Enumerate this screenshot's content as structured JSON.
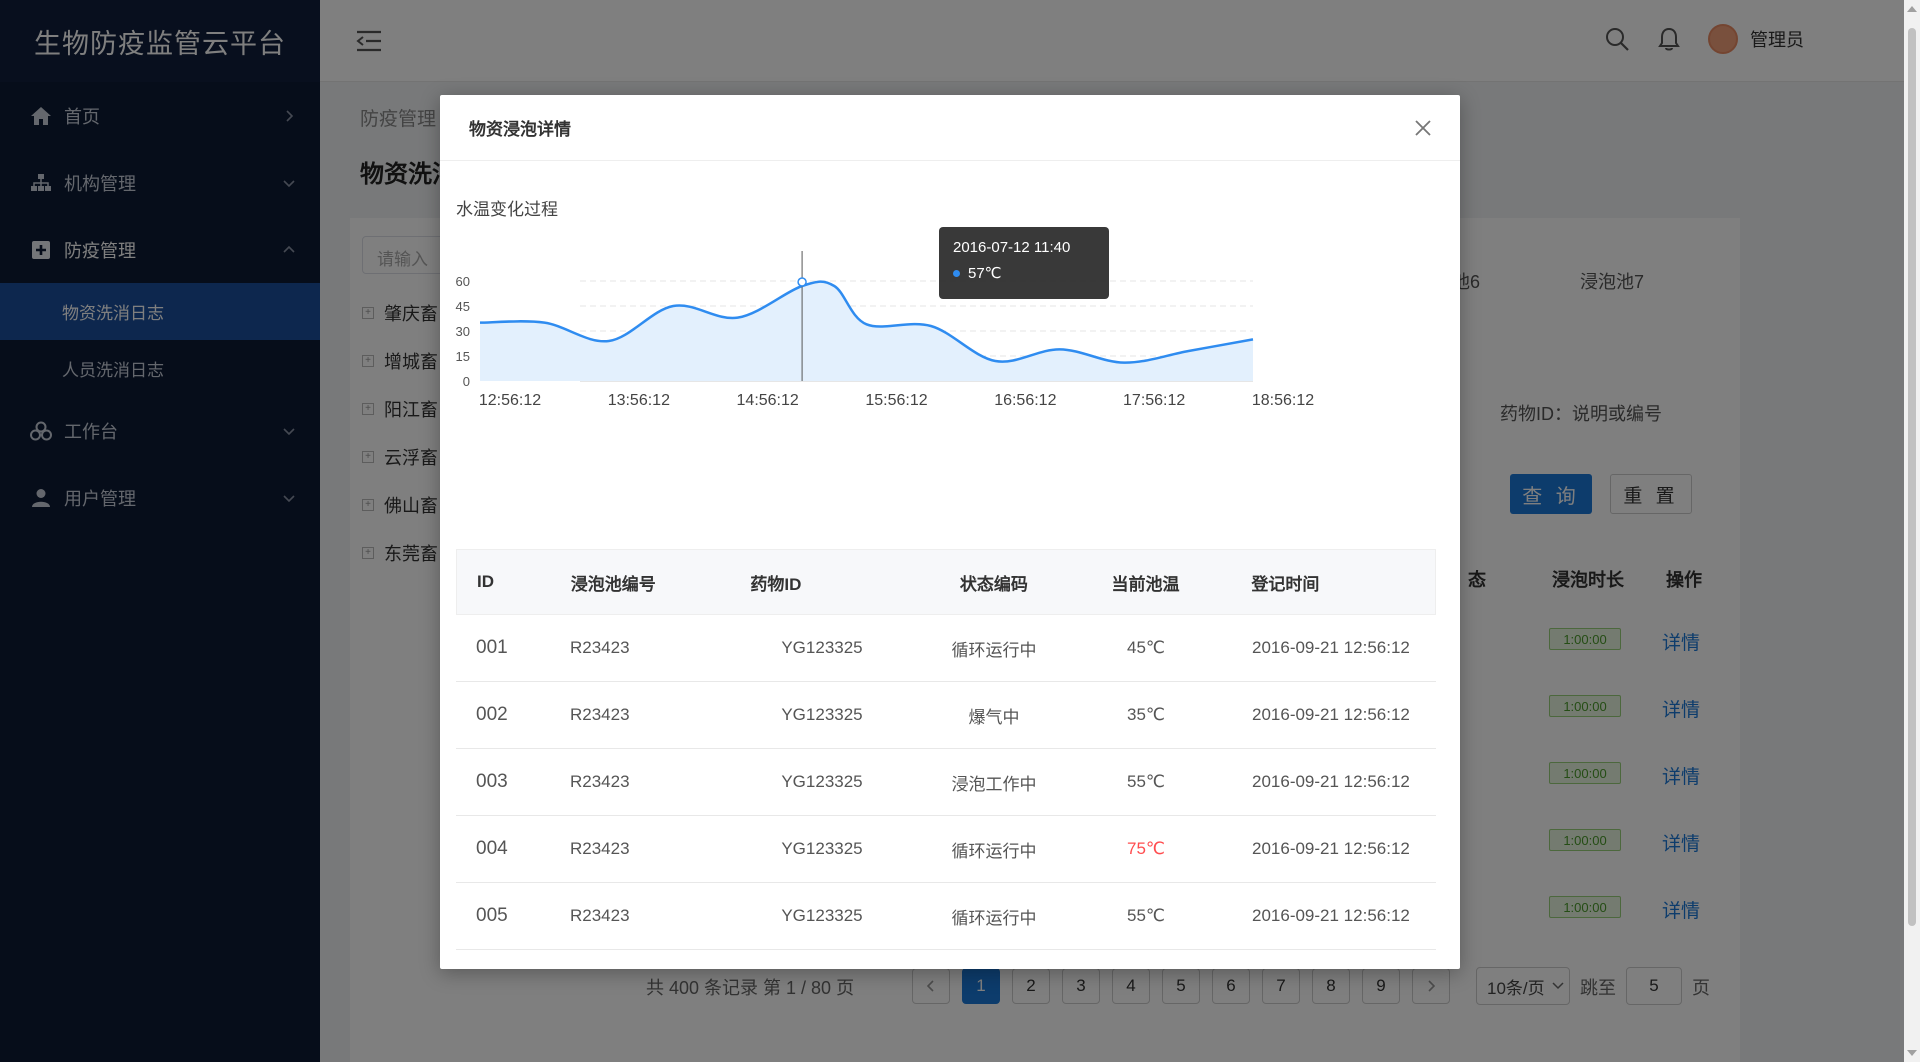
{
  "app": {
    "title": "生物防疫监管云平台"
  },
  "sidebar": {
    "items": [
      {
        "label": "首页",
        "icon": "home-icon"
      },
      {
        "label": "机构管理",
        "icon": "org-icon"
      },
      {
        "label": "防疫管理",
        "icon": "plus-square-icon"
      },
      {
        "label": "工作台",
        "icon": "workbench-icon"
      },
      {
        "label": "用户管理",
        "icon": "user-icon"
      }
    ],
    "sub_items": [
      {
        "label": "物资洗消日志"
      },
      {
        "label": "人员洗消日志"
      }
    ]
  },
  "topbar": {
    "username": "管理员"
  },
  "background": {
    "breadcrumb": "防疫管理",
    "page_title": "物资洗消",
    "search_placeholder": "请输入",
    "tree": [
      "肇庆畜",
      "增城畜",
      "阳江畜",
      "云浮畜",
      "佛山畜",
      "东莞畜"
    ],
    "pool_tabs": [
      "池6",
      "浸泡池7"
    ],
    "drug_label": "药物ID：说明或编号",
    "query_button": "查 询",
    "reset_button": "重 置",
    "headers": [
      "态",
      "浸泡时长",
      "操作"
    ],
    "durations": [
      "1:00:00",
      "1:00:00",
      "1:00:00",
      "1:00:00",
      "1:00:00"
    ],
    "detail_link": "详情",
    "pager_summary": "共 400 条记录 第 1 / 80 页",
    "pages": [
      "1",
      "2",
      "3",
      "4",
      "5",
      "6",
      "7",
      "8",
      "9"
    ],
    "per_page": "10条/页",
    "goto_label": "跳至",
    "goto_value": "5",
    "page_unit": "页"
  },
  "modal": {
    "title": "物资浸泡详情",
    "chart_title": "水温变化过程",
    "tooltip": {
      "time": "2016-07-12  11:40",
      "value": "57℃"
    },
    "table": {
      "headers": [
        "ID",
        "浸泡池编号",
        "药物ID",
        "状态编码",
        "当前池温",
        "登记时间"
      ],
      "rows": [
        {
          "id": "001",
          "pool": "R23423",
          "drug": "YG123325",
          "status": "循环运行中",
          "temp": "45℃",
          "time": "2016-09-21  12:56:12"
        },
        {
          "id": "002",
          "pool": "R23423",
          "drug": "YG123325",
          "status": "爆气中",
          "temp": "35℃",
          "time": "2016-09-21  12:56:12"
        },
        {
          "id": "003",
          "pool": "R23423",
          "drug": "YG123325",
          "status": "浸泡工作中",
          "temp": "55℃",
          "time": "2016-09-21  12:56:12"
        },
        {
          "id": "004",
          "pool": "R23423",
          "drug": "YG123325",
          "status": "循环运行中",
          "temp": "75℃",
          "time": "2016-09-21  12:56:12"
        },
        {
          "id": "005",
          "pool": "R23423",
          "drug": "YG123325",
          "status": "循环运行中",
          "temp": "55℃",
          "time": "2016-09-21  12:56:12"
        }
      ]
    }
  },
  "chart_data": {
    "type": "area",
    "title": "水温变化过程",
    "x": [
      "12:56:12",
      "13:26:12",
      "13:56:12",
      "14:26:12",
      "14:56:12",
      "15:26:12",
      "15:41:12",
      "15:56:12",
      "16:26:12",
      "16:56:12",
      "17:26:12",
      "17:56:12",
      "18:26:12",
      "18:56:12"
    ],
    "x_ticks": [
      "12:56:12",
      "13:56:12",
      "14:56:12",
      "15:56:12",
      "16:56:12",
      "17:56:12",
      "18:56:12"
    ],
    "series": [
      {
        "values": [
          35,
          35,
          24,
          45,
          38,
          57,
          57,
          34,
          33,
          12,
          19,
          11,
          18,
          25
        ]
      }
    ],
    "ylim": [
      0,
      60
    ],
    "y_ticks": [
      0,
      15,
      30,
      45,
      60
    ],
    "grid": true,
    "colors": {
      "line": "#2f8cf0",
      "fill": "#e3f0fd"
    }
  }
}
